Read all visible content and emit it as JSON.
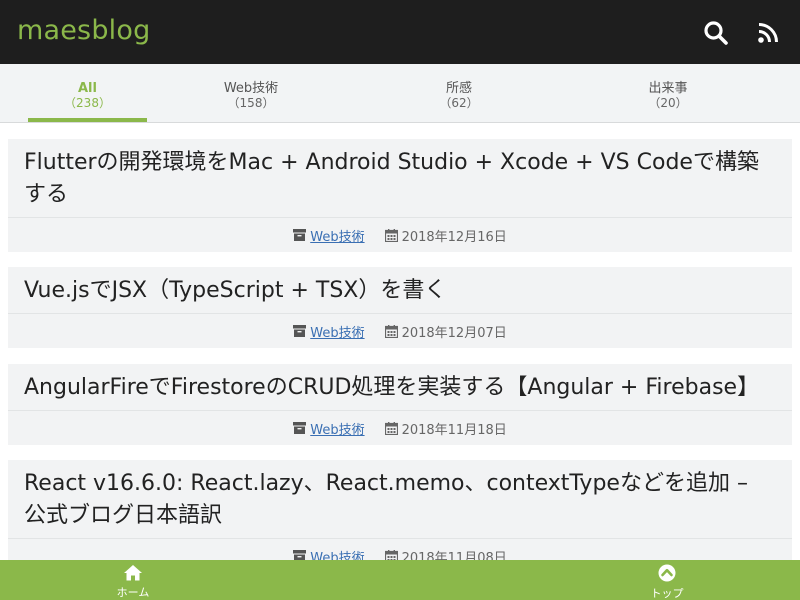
{
  "header": {
    "site_title": "maesblog",
    "search_icon": "search-icon",
    "rss_icon": "rss-icon",
    "bg_color": "#1e1e1e",
    "accent_color": "#8bb84a"
  },
  "tabs": [
    {
      "label": "All",
      "count": "（238）",
      "active": true
    },
    {
      "label": "Web技術",
      "count": "（158）",
      "active": false
    },
    {
      "label": "所感",
      "count": "（62）",
      "active": false
    },
    {
      "label": "出来事",
      "count": "（20）",
      "active": false
    }
  ],
  "posts": [
    {
      "title": "Flutterの開発環境をMac + Android Studio + Xcode + VS Codeで構築する",
      "category": "Web技術",
      "date": "2018年12月16日"
    },
    {
      "title": "Vue.jsでJSX（TypeScript + TSX）を書く",
      "category": "Web技術",
      "date": "2018年12月07日"
    },
    {
      "title": "AngularFireでFirestoreのCRUD処理を実装する【Angular + Firebase】",
      "category": "Web技術",
      "date": "2018年11月18日"
    },
    {
      "title": "React v16.6.0: React.lazy、React.memo、contextTypeなどを追加 – 公式ブログ日本語訳",
      "category": "Web技術",
      "date": "2018年11月08日"
    }
  ],
  "bottom_nav": {
    "home_label": "ホーム",
    "home_icon": "home-icon",
    "top_label": "トップ",
    "top_icon": "arrow-up-circle-icon"
  }
}
